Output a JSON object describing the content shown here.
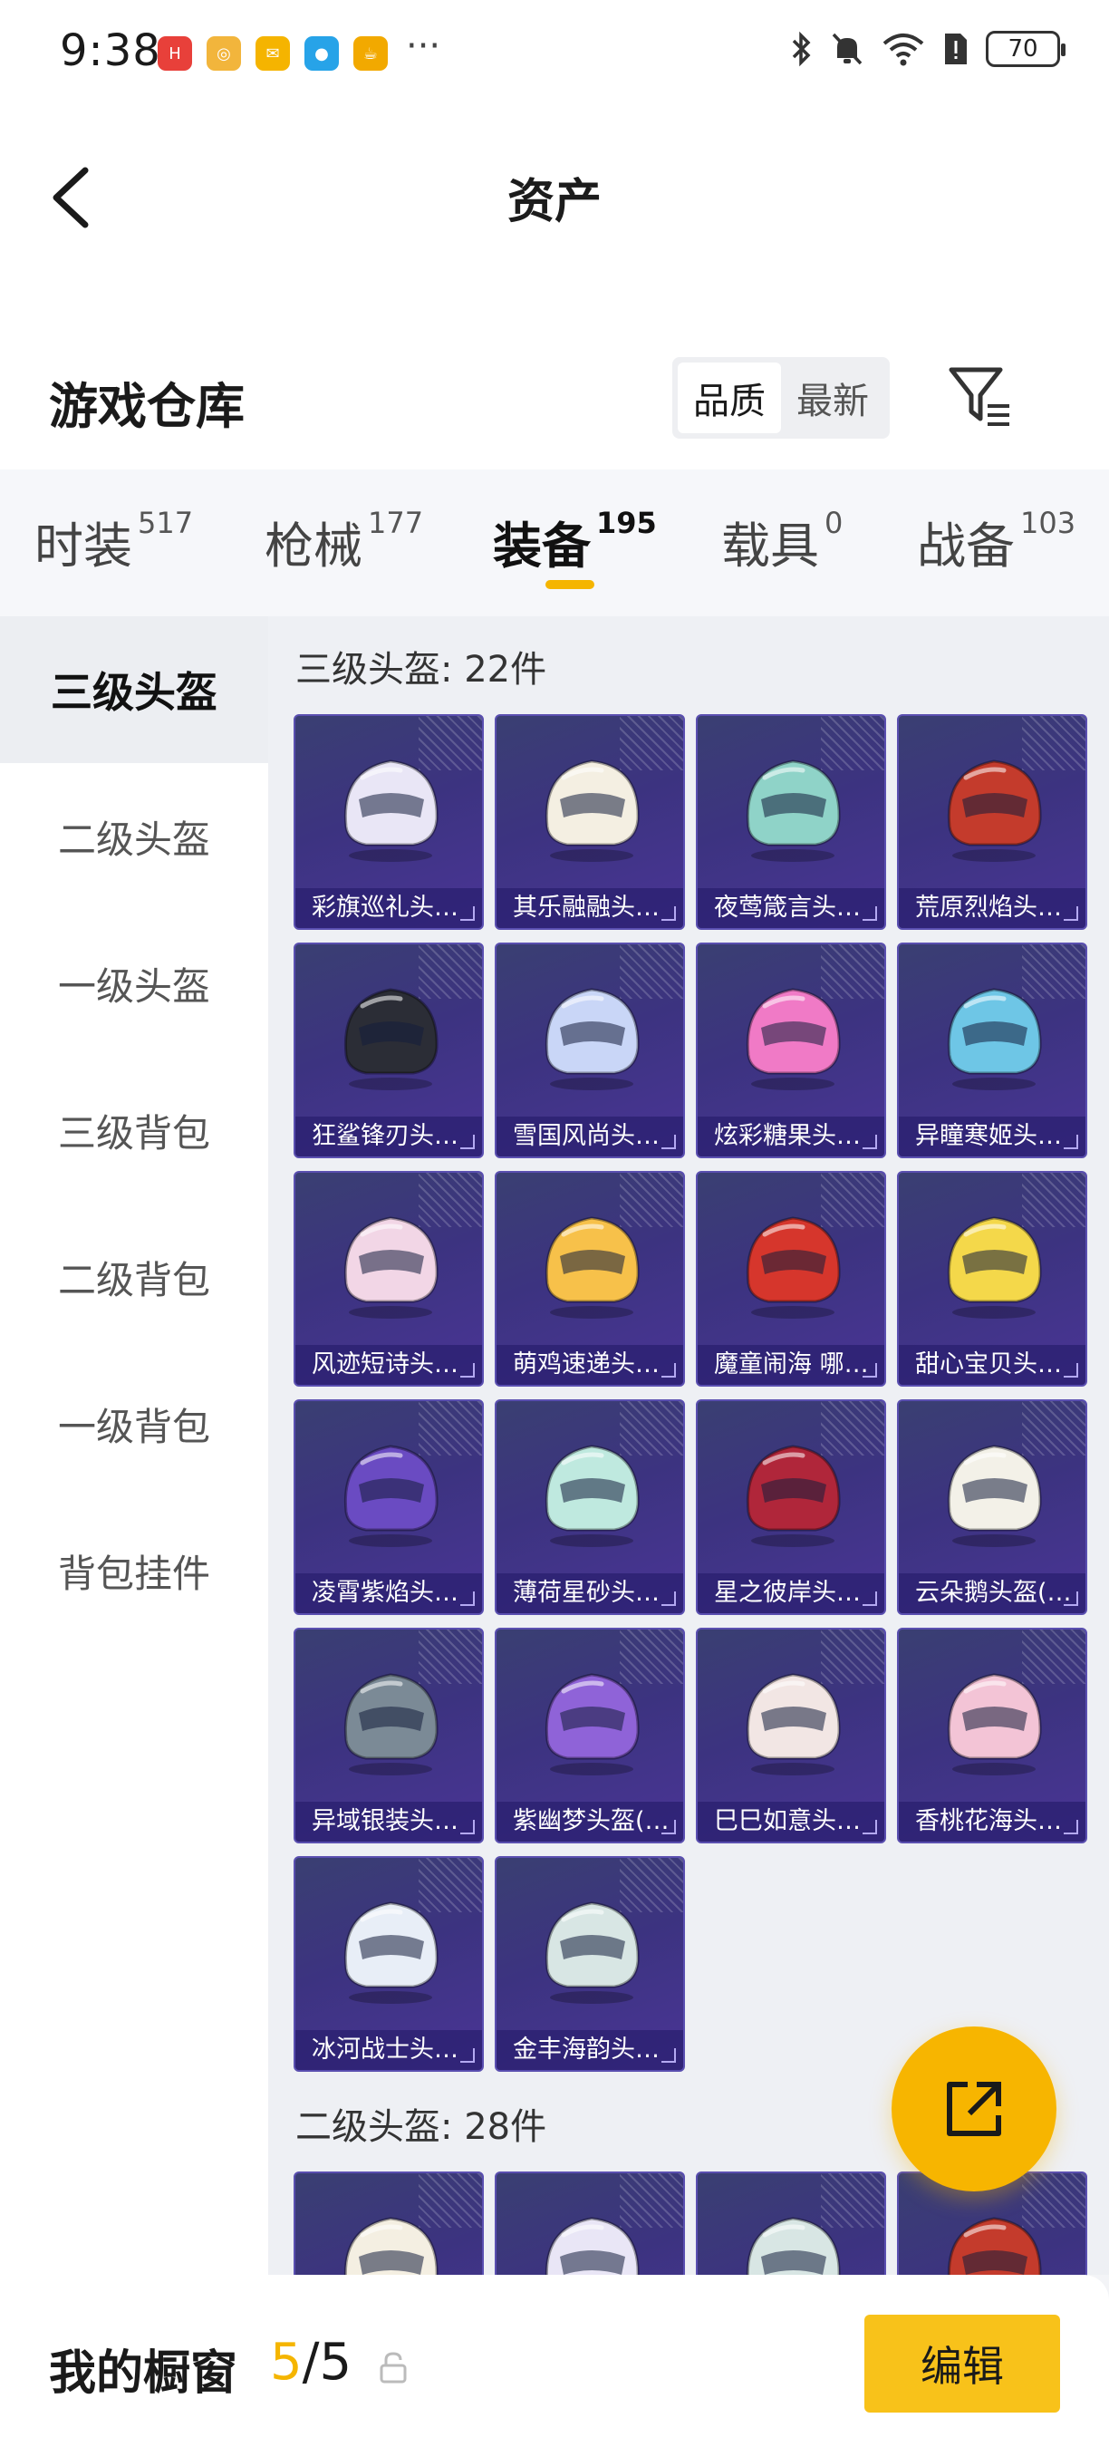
{
  "status_bar": {
    "time": "9:38",
    "battery": "70",
    "app_icons": [
      {
        "name": "huawei-app-icon",
        "color": "#e8403a",
        "glyph": "H"
      },
      {
        "name": "music-app-icon",
        "color": "#f2b53c",
        "glyph": "◎"
      },
      {
        "name": "mail-app-icon",
        "color": "#f5b400",
        "glyph": "✉"
      },
      {
        "name": "browser-app-icon",
        "color": "#27a3e8",
        "glyph": "●"
      },
      {
        "name": "cup-app-icon",
        "color": "#f2a900",
        "glyph": "☕"
      }
    ],
    "more": "···"
  },
  "header": {
    "title": "资产"
  },
  "warehouse": {
    "title": "游戏仓库",
    "sort_options": [
      "品质",
      "最新"
    ],
    "active_sort": "品质"
  },
  "tabs": [
    {
      "label": "时装",
      "count": "517"
    },
    {
      "label": "枪械",
      "count": "177"
    },
    {
      "label": "装备",
      "count": "195"
    },
    {
      "label": "载具",
      "count": "0"
    },
    {
      "label": "战备",
      "count": "103"
    }
  ],
  "active_tab": "装备",
  "sidebar": [
    {
      "label": "三级头盔"
    },
    {
      "label": "二级头盔"
    },
    {
      "label": "一级头盔"
    },
    {
      "label": "三级背包"
    },
    {
      "label": "二级背包"
    },
    {
      "label": "一级背包"
    },
    {
      "label": "背包挂件"
    }
  ],
  "sections": [
    {
      "title": "三级头盔: 22件",
      "items": [
        {
          "name": "彩旗巡礼头…",
          "color": "#e9e6f6"
        },
        {
          "name": "其乐融融头…",
          "color": "#f4efe2"
        },
        {
          "name": "夜莺箴言头…",
          "color": "#8fd3c8"
        },
        {
          "name": "荒原烈焰头…",
          "color": "#c43b2c"
        },
        {
          "name": "狂鲨锋刃头…",
          "color": "#2b2d36"
        },
        {
          "name": "雪国风尚头…",
          "color": "#c9d6f7"
        },
        {
          "name": "炫彩糖果头…",
          "color": "#f07ac6"
        },
        {
          "name": "异瞳寒姬头…",
          "color": "#6ec6e6"
        },
        {
          "name": "风迹短诗头…",
          "color": "#f2d6e6"
        },
        {
          "name": "萌鸡速递头…",
          "color": "#f7c14a"
        },
        {
          "name": "魔童闹海 哪…",
          "color": "#d6362c"
        },
        {
          "name": "甜心宝贝头…",
          "color": "#f4d84a"
        },
        {
          "name": "凌霄紫焰头…",
          "color": "#6a4bc2"
        },
        {
          "name": "薄荷星砂头…",
          "color": "#bfe9df"
        },
        {
          "name": "星之彼岸头…",
          "color": "#b0263a"
        },
        {
          "name": "云朵鹅头盔(…",
          "color": "#f3f1e8"
        },
        {
          "name": "异域银装头…",
          "color": "#7b8a96"
        },
        {
          "name": "紫幽梦头盔(…",
          "color": "#8f63d8"
        },
        {
          "name": "巳巳如意头…",
          "color": "#f2e6e4"
        },
        {
          "name": "香桃花海头…",
          "color": "#f3c4d6"
        },
        {
          "name": "冰河战士头…",
          "color": "#e8eef7"
        },
        {
          "name": "金丰海韵头…",
          "color": "#d8e6e4"
        }
      ]
    },
    {
      "title": "二级头盔: 28件",
      "items": [
        {
          "name": "",
          "color": "#f4efe2"
        },
        {
          "name": "",
          "color": "#e9e6f6"
        },
        {
          "name": "",
          "color": "#d8e6e4"
        },
        {
          "name": "",
          "color": "#c43b2c"
        }
      ]
    }
  ],
  "bottom": {
    "title": "我的橱窗",
    "count_current": "5",
    "count_sep_total": "/5",
    "edit_label": "编辑"
  }
}
